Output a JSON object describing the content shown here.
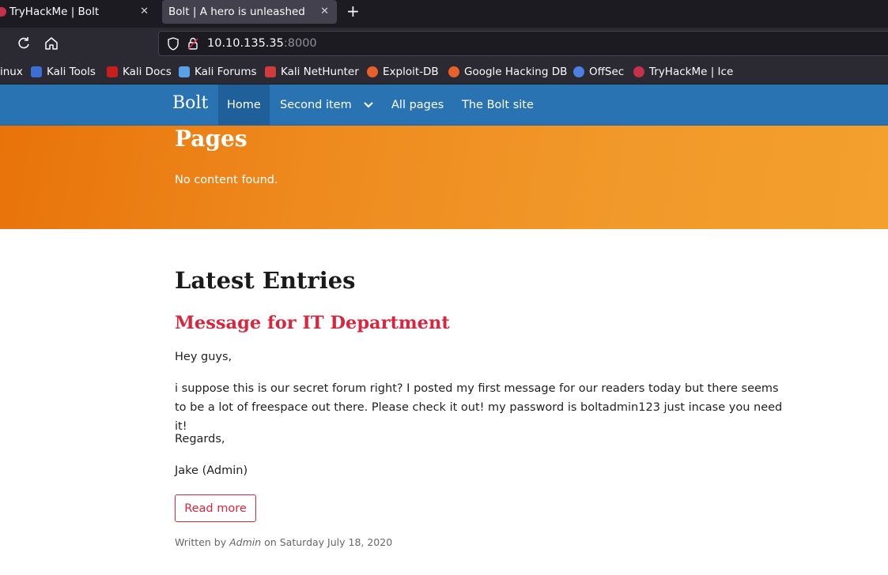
{
  "browser": {
    "tabs": [
      {
        "title": "TryHackMe | Bolt"
      },
      {
        "title": "Bolt | A hero is unleashed"
      }
    ],
    "url_host": "10.10.135.35",
    "url_port": ":8000",
    "bookmarks": [
      {
        "label": "inux",
        "icon": "kali-linux-icon",
        "color": "#2d7bd6"
      },
      {
        "label": "Kali Tools",
        "icon": "kali-tools-icon",
        "color": "#3b6fd4"
      },
      {
        "label": "Kali Docs",
        "icon": "kali-docs-icon",
        "color": "#c81e1e"
      },
      {
        "label": "Kali Forums",
        "icon": "kali-forums-icon",
        "color": "#5aa0e6"
      },
      {
        "label": "Kali NetHunter",
        "icon": "kali-nethunter-icon",
        "color": "#d23b3b"
      },
      {
        "label": "Exploit-DB",
        "icon": "exploit-db-icon",
        "color": "#e8612c"
      },
      {
        "label": "Google Hacking DB",
        "icon": "ghdb-icon",
        "color": "#e8612c"
      },
      {
        "label": "OffSec",
        "icon": "offsec-icon",
        "color": "#4c7fe0"
      },
      {
        "label": "TryHackMe | Ice",
        "icon": "tryhackme-icon",
        "color": "#c4314b"
      }
    ]
  },
  "site": {
    "brand": "Bolt",
    "nav": {
      "home": "Home",
      "second": "Second item",
      "all_pages": "All pages",
      "bolt_site": "The Bolt site"
    },
    "colors": {
      "nav": "#2a73b3",
      "accent": "#d7263d",
      "hero": "#ee8a1e"
    }
  },
  "hero": {
    "title": "Pages",
    "subtitle": "No content found."
  },
  "main": {
    "heading": "Latest Entries",
    "entry": {
      "title": "Message for IT Department",
      "paragraphs": [
        "Hey guys,",
        "i suppose this is our secret forum right? I posted my first message for our readers today but there seems to be a lot of freespace out there. Please check it out! my password is boltadmin123 just incase you need it!",
        "Regards,",
        "Jake (Admin)"
      ],
      "read_more": "Read more",
      "meta_prefix": "Written by",
      "author": "Admin",
      "meta_on": "on",
      "date": "Saturday July 18, 2020"
    }
  }
}
